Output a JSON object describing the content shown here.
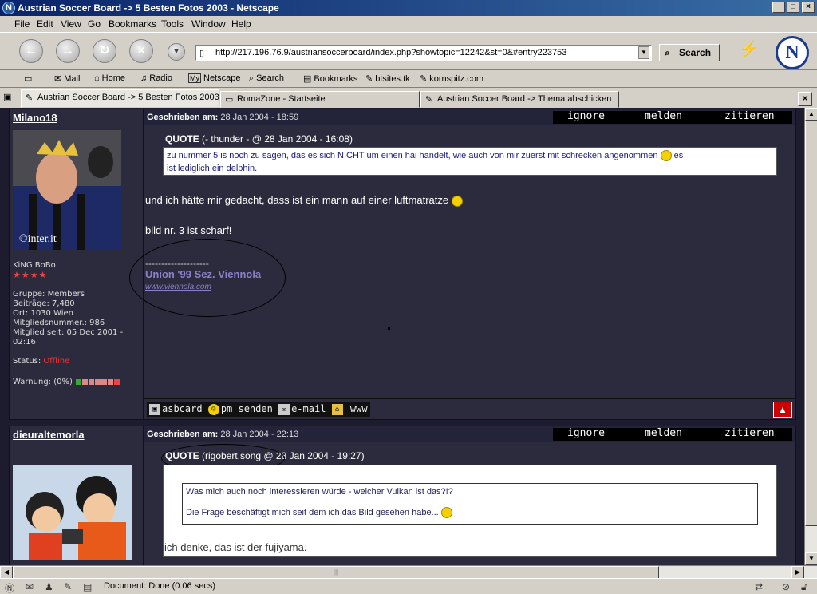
{
  "window": {
    "title": "Austrian Soccer Board -> 5 Besten Fotos 2003 - Netscape",
    "app_icon": "N"
  },
  "menu": [
    "File",
    "Edit",
    "View",
    "Go",
    "Bookmarks",
    "Tools",
    "Window",
    "Help"
  ],
  "nav": {
    "url": "http://217.196.76.9/austriansoccerboard/index.php?showtopic=12242&st=0&#entry223753",
    "search_label": "Search",
    "logo": "N"
  },
  "personal_toolbar": {
    "mail": "Mail",
    "home": "Home",
    "radio": "Radio",
    "my_icon": "My",
    "netscape": "Netscape",
    "search": "Search",
    "bookmarks": "Bookmarks",
    "btsites": "btsites.tk",
    "kornspitz": "kornspitz.com"
  },
  "tabs": [
    {
      "label": "Austrian Soccer Board -> 5 Besten Fotos 2003"
    },
    {
      "label": "RomaZone - Startseite"
    },
    {
      "label": "Austrian Soccer Board -> Thema abschicken"
    }
  ],
  "post_actions": {
    "ignore": "ignore",
    "report": "melden",
    "quote": "zitieren"
  },
  "post1": {
    "username": "Milano18",
    "posted_label": "Geschrieben am:",
    "posted_date": "28 Jan 2004 - 18:59",
    "avatar_caption": "©inter.it",
    "title": "KiNG BoBo",
    "stars": "★★★★",
    "group": "Gruppe: Members",
    "posts": "Beiträge: 7,480",
    "location": "Ort: 1030 Wien",
    "member_number": "Mitgliedsnummer.: 986",
    "member_since": "Mitglied seit: 05 Dec 2001 -",
    "member_since_time": "02:16",
    "status_label": "Status:",
    "status_value": "Offline",
    "warning_label": "Warnung: (0%)",
    "quote_label": "QUOTE",
    "quote_source": " (- thunder - @ 28 Jan 2004 - 16:08)",
    "quote_text_1": "zu nummer 5 is noch zu sagen, das es sich NICHT um einen hai handelt, wie auch von mir zuerst mit schrecken angenommen",
    "quote_text_1b": " es",
    "quote_text_2": "ist lediglich ein delphin.",
    "body_1": "und ich hätte mir gedacht, dass ist ein mann auf einer luftmatratze",
    "body_2": "bild nr. 3 ist scharf!",
    "sig_dashes": "--------------------",
    "sig_title": "Union '99 Sez. Viennola",
    "sig_link": "www.viennola.com",
    "footer": {
      "asbcard": "asbcard",
      "pm": "pm senden",
      "email": "e-mail",
      "www": "www"
    },
    "top_arrow": "▲"
  },
  "post2": {
    "username": "dieuraltemorla",
    "posted_label": "Geschrieben am:",
    "posted_date": "28 Jan 2004 - 22:13",
    "quote_label": "QUOTE",
    "quote_source": " (rigobert.song @ 28 Jan 2004 - 19:27)",
    "inner_1": "Was mich auch noch interessieren würde - welcher Vulkan ist das?!?",
    "inner_2": "Die Frage beschäftigt mich seit dem ich das Bild gesehen habe...",
    "body": "ich denke, das ist der fujiyama."
  },
  "status": {
    "text": "Document: Done (0.06 secs)"
  },
  "colors": {
    "title_bar": "#0a246a",
    "board_bg": "#2b2b3d",
    "offline": "#e33333",
    "signature": "#8a82c8"
  }
}
